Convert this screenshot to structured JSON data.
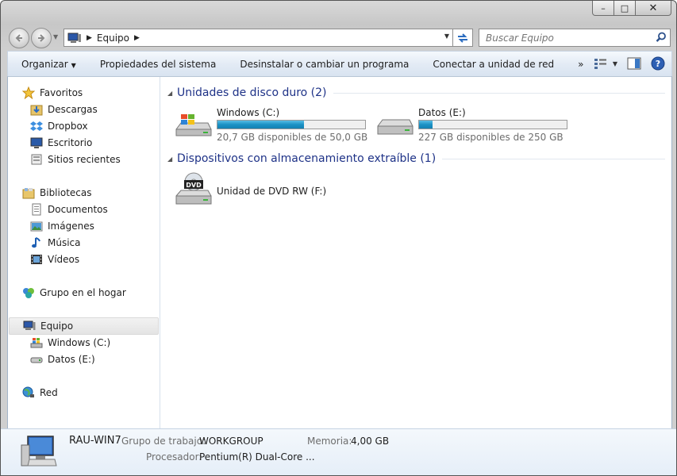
{
  "window": {
    "minimize_symbol": "–",
    "maximize_symbol": "□",
    "close_symbol": "✕"
  },
  "address": {
    "root": "Equipo"
  },
  "search": {
    "placeholder": "Buscar Equipo"
  },
  "toolbar": {
    "organize": "Organizar",
    "system_properties": "Propiedades del sistema",
    "uninstall": "Desinstalar o cambiar un programa",
    "map_drive": "Conectar a unidad de red",
    "more": "»"
  },
  "sidebar": {
    "favorites": "Favoritos",
    "downloads": "Descargas",
    "dropbox": "Dropbox",
    "desktop": "Escritorio",
    "recent": "Sitios recientes",
    "libraries": "Bibliotecas",
    "documents": "Documentos",
    "pictures": "Imágenes",
    "music": "Música",
    "videos": "Vídeos",
    "homegroup": "Grupo en el hogar",
    "computer": "Equipo",
    "drive_c": "Windows (C:)",
    "drive_e": "Datos (E:)",
    "network": "Red"
  },
  "groups": {
    "hard_disks": "Unidades de disco duro (2)",
    "removable": "Dispositivos con almacenamiento extraíble (1)"
  },
  "drives": [
    {
      "name": "Windows (C:)",
      "info": "20,7 GB disponibles de 50,0 GB",
      "used_fraction": 0.586
    },
    {
      "name": "Datos (E:)",
      "info": "227 GB disponibles de 250 GB",
      "used_fraction": 0.092
    }
  ],
  "dvd": {
    "name": "Unidad de DVD RW (F:)",
    "badge": "DVD"
  },
  "details": {
    "computer_name": "RAU-WIN7",
    "workgroup_label": "Grupo de trabajo:",
    "workgroup_value": "WORKGROUP",
    "memory_label": "Memoria:",
    "memory_value": "4,00 GB",
    "processor_label": "Procesador:",
    "processor_value": "Pentium(R) Dual-Core ..."
  },
  "colors": {
    "accent_title": "#1e3287",
    "bar_fill": "#1c92c5"
  }
}
